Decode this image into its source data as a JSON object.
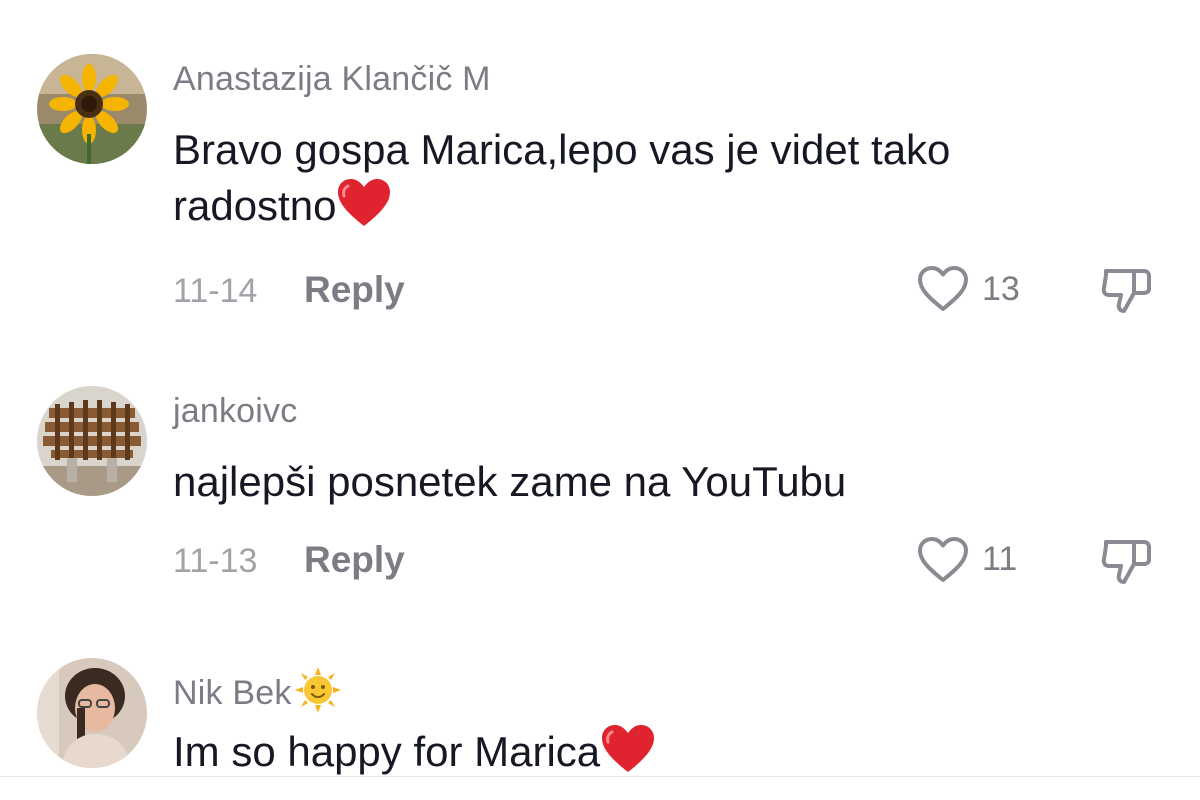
{
  "comments": [
    {
      "username": "Anastazija Klančič M",
      "text_line1": "Bravo gospa Marica,lepo vas je videt tako",
      "text_line2": "radostno",
      "date": "11-14",
      "reply_label": "Reply",
      "like_count": "13",
      "avatar_icon": "sunflower-avatar"
    },
    {
      "username": "jankoivc",
      "text_line1": "najlepši posnetek zame na YouTubu",
      "date": "11-13",
      "reply_label": "Reply",
      "like_count": "11",
      "avatar_icon": "wooden-structure-avatar"
    },
    {
      "username": "Nik Bek",
      "text_line1": "Im so happy for Marica",
      "avatar_icon": "portrait-avatar"
    }
  ],
  "icons": {
    "like": "heart-outline-icon",
    "dislike": "thumbs-down-icon",
    "heart_emoji": "red-heart-emoji",
    "sun_emoji": "sun-face-emoji"
  },
  "colors": {
    "username": "#7c7c84",
    "text": "#161823",
    "meta": "#a2a2a8",
    "heart": "#e0242f"
  }
}
